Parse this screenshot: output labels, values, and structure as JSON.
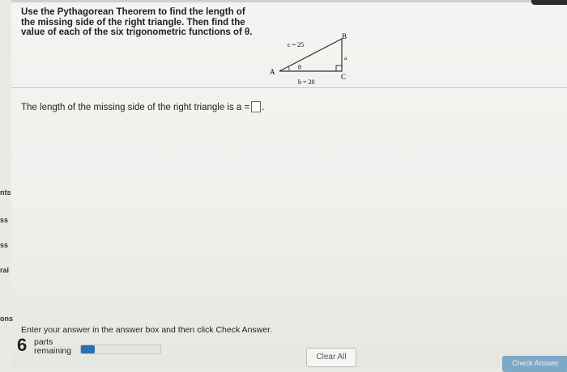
{
  "question": {
    "text": "Use the Pythagorean Theorem to find the length of the missing side of the right triangle. Then find the value of each of the six trigonometric functions of θ."
  },
  "triangle": {
    "vertex_a": "A",
    "vertex_b": "B",
    "vertex_c": "C",
    "hypotenuse": "c = 25",
    "base": "b = 20",
    "side_a": "a",
    "angle": "θ"
  },
  "prompt": {
    "text": "The length of the missing side of the right triangle is a =",
    "answer_value": "",
    "period": "."
  },
  "sidebar": {
    "labels": [
      "nts",
      "ss",
      "ss",
      "ral",
      "ons"
    ]
  },
  "footer": {
    "instructions": "Enter your answer in the answer box and then click Check Answer.",
    "parts_count": "6",
    "parts_label_line1": "parts",
    "parts_label_line2": "remaining",
    "progress_fraction": 0.17,
    "clear_all": "Clear All",
    "check_answer": "Check Answer"
  },
  "colors": {
    "progress": "#2a6fb3",
    "check_button": "#7ea8c6"
  }
}
